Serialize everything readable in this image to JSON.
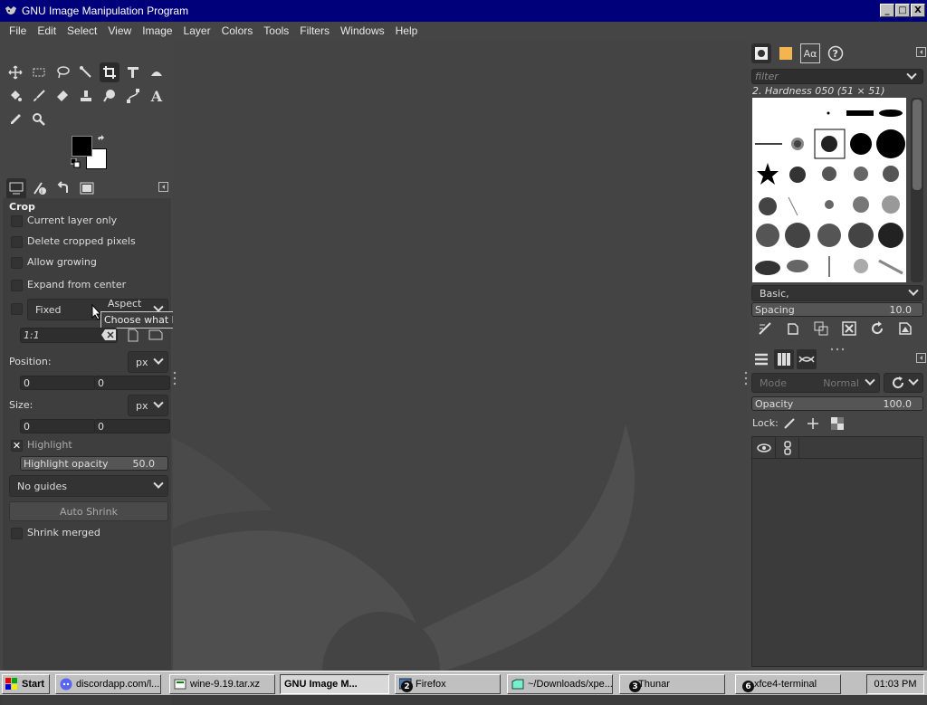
{
  "window": {
    "title": "GNU Image Manipulation Program",
    "minimize": "_",
    "maximize": "□",
    "close": "X"
  },
  "menu": [
    "File",
    "Edit",
    "Select",
    "View",
    "Image",
    "Layer",
    "Colors",
    "Tools",
    "Filters",
    "Windows",
    "Help"
  ],
  "tool_options": {
    "title": "Crop",
    "current_layer_only": "Current layer only",
    "delete_cropped": "Delete cropped pixels",
    "allow_growing": "Allow growing",
    "expand_center": "Expand from center",
    "fixed_label": "Fixed",
    "fixed_mode": "Aspect ratio",
    "tooltip": "Choose what has to be locked",
    "ratio_value": "1:1",
    "position_label": "Position:",
    "position_unit": "px",
    "position_x": "0",
    "position_y": "0",
    "size_label": "Size:",
    "size_unit": "px",
    "size_w": "0",
    "size_h": "0",
    "highlight": "Highlight",
    "highlight_opacity_label": "Highlight opacity",
    "highlight_opacity_value": "50.0",
    "guides": "No guides",
    "auto_shrink": "Auto Shrink",
    "shrink_merged": "Shrink merged"
  },
  "brushes": {
    "filter_placeholder": "filter",
    "current": "2. Hardness 050 (51 × 51)",
    "tag": "Basic,",
    "spacing_label": "Spacing",
    "spacing_value": "10.0"
  },
  "layers": {
    "mode_label": "Mode",
    "mode_value": "Normal",
    "opacity_label": "Opacity",
    "opacity_value": "100.0",
    "lock_label": "Lock:"
  },
  "taskbar": {
    "start": "Start",
    "tasks": [
      "discordapp.com/l...",
      "wine-9.19.tar.xz",
      "GNU Image M...",
      "Firefox",
      "~/Downloads/xpe...",
      "Thunar",
      "xfce4-terminal"
    ],
    "badges": [
      "2",
      "3",
      "6"
    ],
    "clock": "01:03 PM"
  },
  "colors": {
    "accent_title": "#00007b",
    "panel": "#454545",
    "canvas": "#444444"
  }
}
